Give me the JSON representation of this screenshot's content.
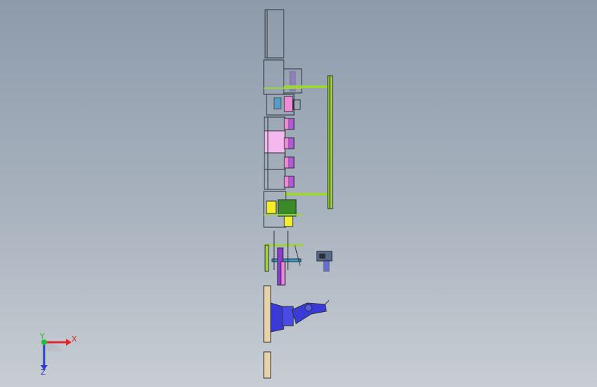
{
  "viewport": {
    "background_top": "#8d9bab",
    "background_bottom": "#c8cdd3"
  },
  "triad": {
    "x_label": "X",
    "y_label": "Y",
    "z_label": "Z",
    "x_color": "#e0262a",
    "y_color": "#1fbf3a",
    "z_color": "#2a3fcf"
  },
  "model": {
    "name_icon": "production-line-assembly-icon",
    "frame_color": "#2b2f36",
    "beam_color": "#9fd33a",
    "pink": "#f08ad8",
    "purple": "#8a3ad0",
    "green_box": "#3a8a2a",
    "yellow": "#f2ee2a",
    "robot_blue": "#3a3ad6",
    "tan": "#e8d3a8"
  }
}
